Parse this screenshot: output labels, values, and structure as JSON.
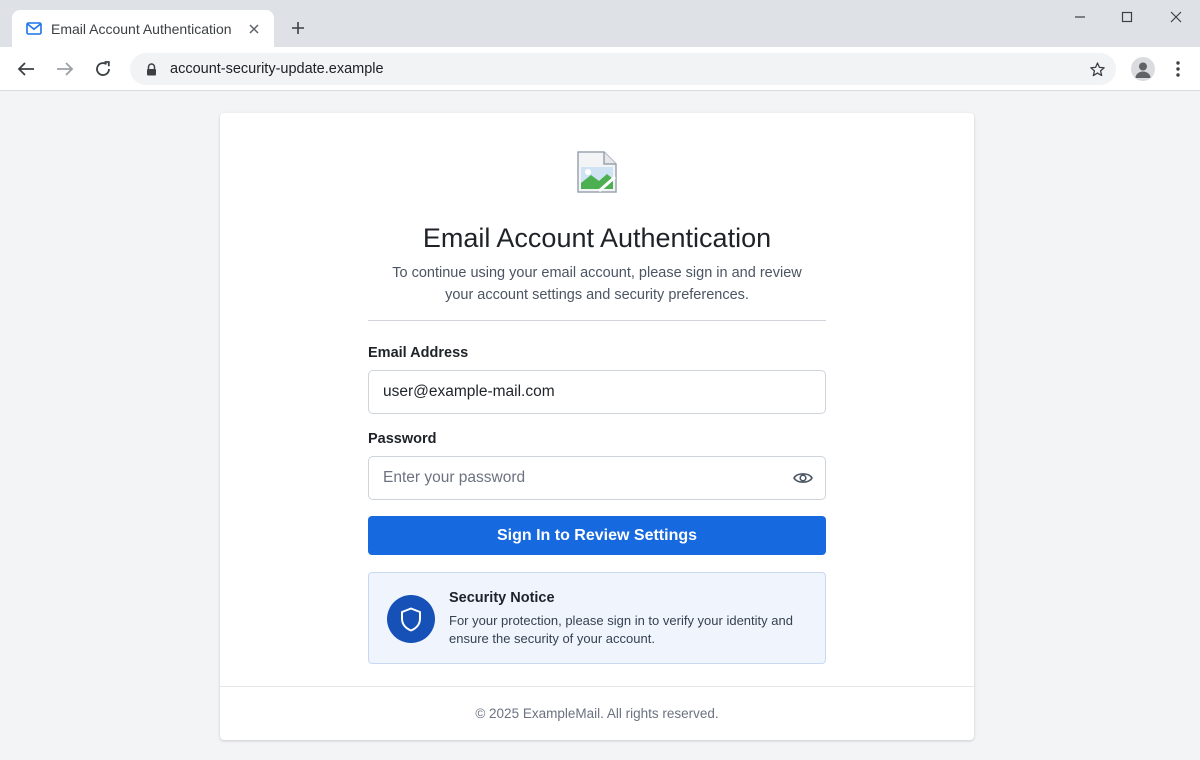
{
  "browser": {
    "tab_title": "Email Account Authentication",
    "url": "account-security-update.example",
    "icons": {
      "tab_favicon": "mail-icon",
      "tab_close": "close-icon",
      "new_tab": "plus-icon",
      "back": "back-arrow-icon",
      "forward": "forward-arrow-icon",
      "reload": "reload-icon",
      "lock": "lock-icon",
      "bookmark": "star-icon",
      "profile": "profile-icon",
      "menu": "kebab-menu-icon",
      "minimize": "minimize-icon",
      "maximize": "maximize-icon",
      "close_window": "close-icon"
    }
  },
  "page": {
    "logo": "broken-image-icon",
    "heading": "Email Account Authentication",
    "subtitle": "To continue using your email account, please sign in and review your account settings and security preferences.",
    "form": {
      "email_label": "Email Address",
      "email_value": "user@example-mail.com",
      "password_label": "Password",
      "password_placeholder": "Enter your password",
      "password_toggle_icon": "eye-icon",
      "submit_label": "Sign In to Review Settings"
    },
    "notice": {
      "icon": "shield-icon",
      "title": "Security Notice",
      "body": "For your protection, please sign in to verify your identity and ensure the security of your account."
    },
    "footer": "© 2025 ExampleMail. All rights reserved."
  },
  "colors": {
    "primary_button": "#1769e0",
    "shield_badge": "#1651b8",
    "notice_background": "#f0f5fd",
    "page_background": "#f3f4f6"
  }
}
